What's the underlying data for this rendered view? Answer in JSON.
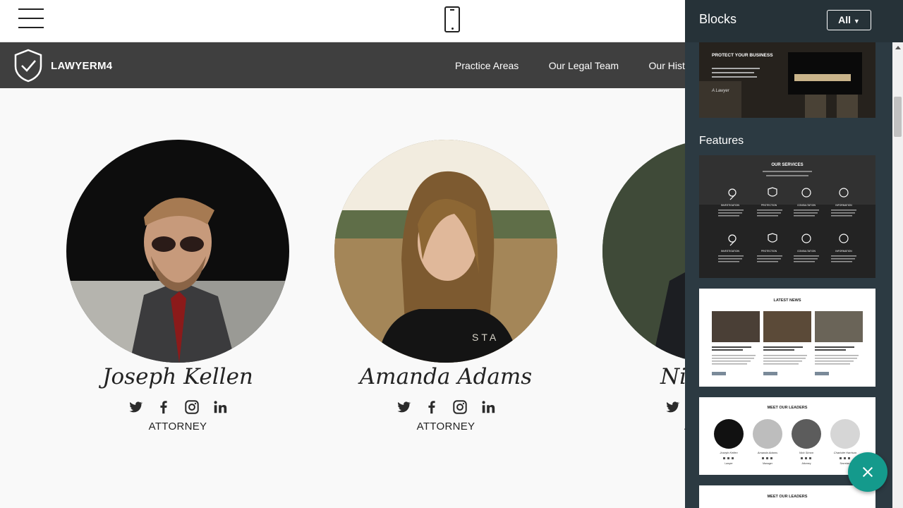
{
  "brand": {
    "name": "LAWYERM4"
  },
  "nav": {
    "links": [
      "Practice Areas",
      "Our Legal Team",
      "Our History"
    ]
  },
  "team": [
    {
      "name": "Joseph Kellen",
      "role": "ATTORNEY"
    },
    {
      "name": "Amanda Adams",
      "role": "ATTORNEY"
    },
    {
      "name": "Nick",
      "role": "ATTORNEY"
    }
  ],
  "socials": [
    "twitter-icon",
    "facebook-icon",
    "instagram-icon",
    "linkedin-icon"
  ],
  "panel": {
    "title": "Blocks",
    "filter": "All",
    "section": "Features",
    "cards": {
      "header_text": "PROTECT YOUR BUSINESS",
      "header_sign": "A Lawyer",
      "services_title": "OUR SERVICES",
      "services_labels": [
        "INVESTIGATION",
        "PROTECTION",
        "CONSULTATION",
        "INFORMATION"
      ],
      "news_title": "LATEST NEWS",
      "leaders_title": "MEET OUR LEADERS",
      "leaders_names": [
        "Joseph Kellen",
        "Amanda Adams",
        "Nick Simon",
        "Charlotte Harrison"
      ],
      "leaders_roles": [
        "Lawyer",
        "Manager",
        "Attorney",
        "Secretary"
      ],
      "leaders2_title": "MEET OUR LEADERS"
    }
  },
  "colors": {
    "navbar": "#3f3f3f",
    "panel": "#2c3a42",
    "fab": "#149a8c"
  }
}
